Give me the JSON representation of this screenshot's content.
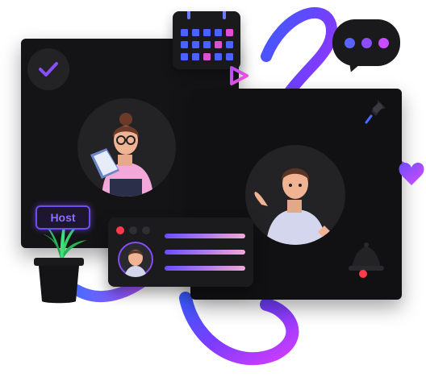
{
  "host_badge": {
    "label": "Host"
  },
  "colors": {
    "ribbon_start": "#3b5bff",
    "ribbon_mid": "#7c3cff",
    "ribbon_end": "#d13cff",
    "panel_dark": "#141416",
    "accent_purple": "#7c4dff",
    "accent_pink": "#e14ed6",
    "check_purple": "#8a4dff"
  },
  "icons": {
    "check": "checkmark-icon",
    "calendar": "calendar-icon",
    "chat": "chat-bubble-icon",
    "pin": "pushpin-icon",
    "bell": "bell-icon",
    "play": "play-icon",
    "heart": "heart-icon",
    "plant": "potted-plant-icon"
  },
  "participants": [
    {
      "role": "woman-reading",
      "icon": "woman-avatar-icon"
    },
    {
      "role": "man-talking",
      "icon": "man-avatar-icon"
    }
  ]
}
